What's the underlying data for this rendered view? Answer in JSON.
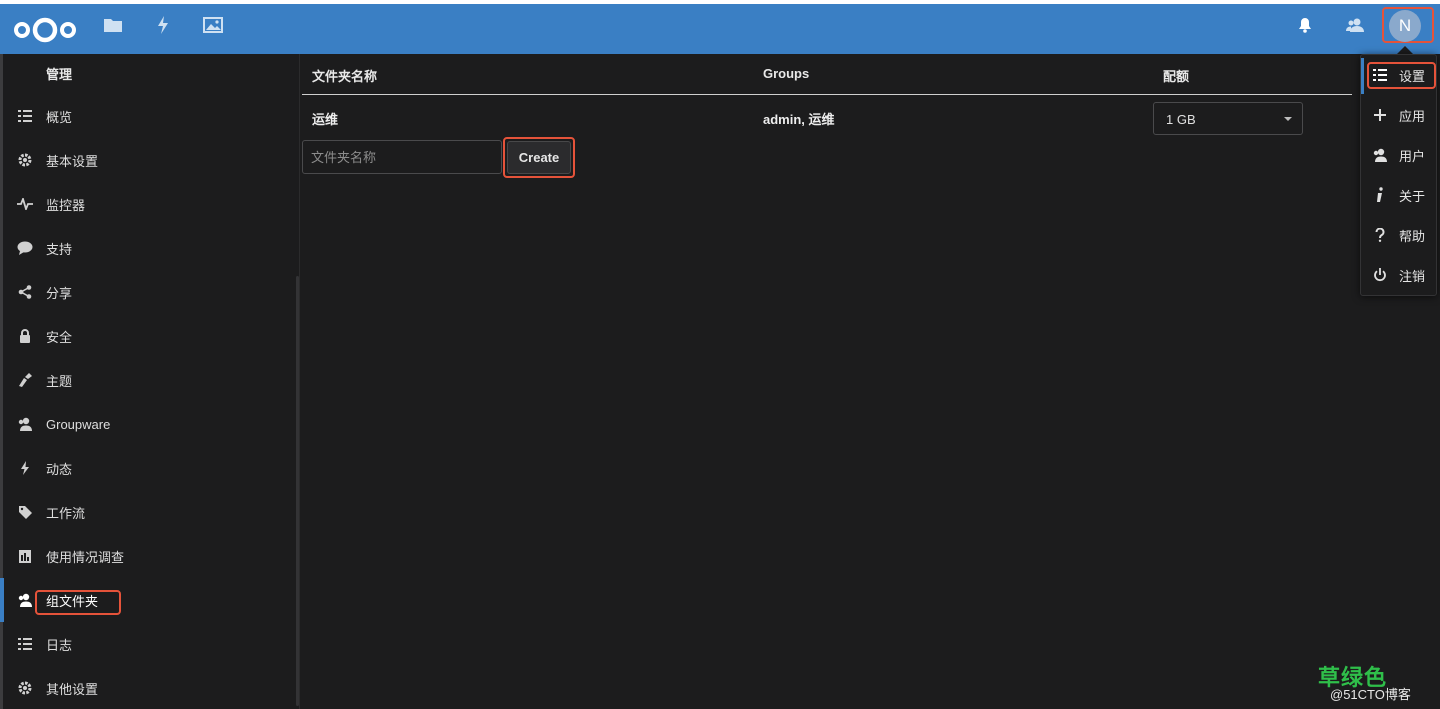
{
  "header": {
    "icons": [
      "nextcloud-logo",
      "files-icon",
      "activity-icon",
      "gallery-icon",
      "notifications-icon",
      "contacts-icon"
    ],
    "avatar_letter": "N",
    "colors": {
      "header_bg": "#3a7fc4",
      "highlight": "#e5533a",
      "accent": "#3a7fc4"
    }
  },
  "sidebar": {
    "heading": "管理",
    "items": [
      {
        "label": "概览",
        "icon": "list-icon"
      },
      {
        "label": "基本设置",
        "icon": "gear-icon"
      },
      {
        "label": "监控器",
        "icon": "pulse-icon"
      },
      {
        "label": "支持",
        "icon": "comment-icon"
      },
      {
        "label": "分享",
        "icon": "share-icon"
      },
      {
        "label": "安全",
        "icon": "lock-icon"
      },
      {
        "label": "主题",
        "icon": "brush-icon"
      },
      {
        "label": "Groupware",
        "icon": "group-icon"
      },
      {
        "label": "动态",
        "icon": "lightning-icon"
      },
      {
        "label": "工作流",
        "icon": "tag-icon"
      },
      {
        "label": "使用情况调查",
        "icon": "survey-icon"
      },
      {
        "label": "组文件夹",
        "icon": "group-folder-icon",
        "active": true
      },
      {
        "label": "日志",
        "icon": "log-icon"
      },
      {
        "label": "其他设置",
        "icon": "gear-icon"
      }
    ]
  },
  "table": {
    "headers": [
      "文件夹名称",
      "Groups",
      "配额"
    ],
    "rows": [
      {
        "name": "运维",
        "groups": "admin, 运维",
        "quota": "1 GB"
      }
    ]
  },
  "new_folder": {
    "placeholder": "文件夹名称",
    "value": "",
    "button": "Create"
  },
  "menu": {
    "items": [
      {
        "label": "设置",
        "icon": "settings-list-icon",
        "active": true
      },
      {
        "label": "应用",
        "icon": "plus-icon"
      },
      {
        "label": "用户",
        "icon": "users-icon"
      },
      {
        "label": "关于",
        "icon": "info-icon"
      },
      {
        "label": "帮助",
        "icon": "help-icon"
      },
      {
        "label": "注销",
        "icon": "power-icon"
      }
    ]
  },
  "watermark": {
    "line1": "草绿色",
    "line2": "@51CTO博客"
  }
}
